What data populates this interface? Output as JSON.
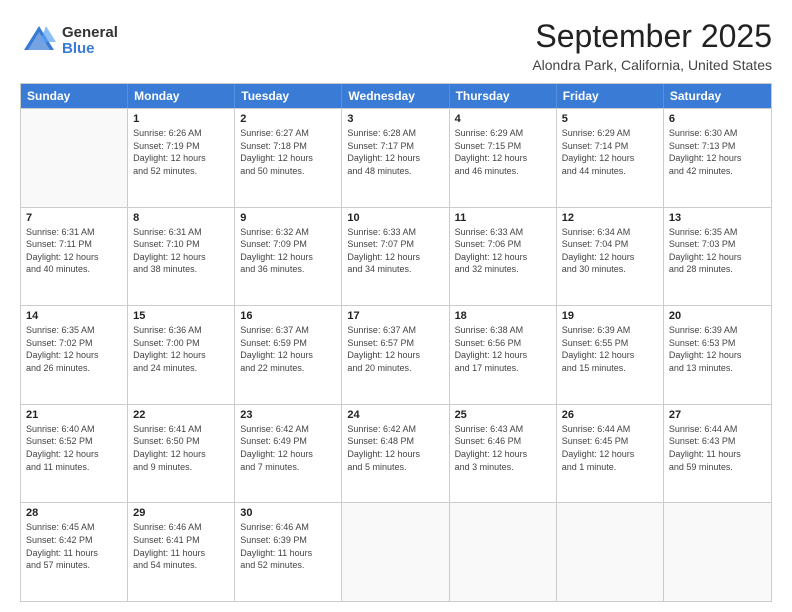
{
  "logo": {
    "general": "General",
    "blue": "Blue"
  },
  "title": "September 2025",
  "subtitle": "Alondra Park, California, United States",
  "header_days": [
    "Sunday",
    "Monday",
    "Tuesday",
    "Wednesday",
    "Thursday",
    "Friday",
    "Saturday"
  ],
  "weeks": [
    [
      {
        "num": "",
        "info": ""
      },
      {
        "num": "1",
        "info": "Sunrise: 6:26 AM\nSunset: 7:19 PM\nDaylight: 12 hours\nand 52 minutes."
      },
      {
        "num": "2",
        "info": "Sunrise: 6:27 AM\nSunset: 7:18 PM\nDaylight: 12 hours\nand 50 minutes."
      },
      {
        "num": "3",
        "info": "Sunrise: 6:28 AM\nSunset: 7:17 PM\nDaylight: 12 hours\nand 48 minutes."
      },
      {
        "num": "4",
        "info": "Sunrise: 6:29 AM\nSunset: 7:15 PM\nDaylight: 12 hours\nand 46 minutes."
      },
      {
        "num": "5",
        "info": "Sunrise: 6:29 AM\nSunset: 7:14 PM\nDaylight: 12 hours\nand 44 minutes."
      },
      {
        "num": "6",
        "info": "Sunrise: 6:30 AM\nSunset: 7:13 PM\nDaylight: 12 hours\nand 42 minutes."
      }
    ],
    [
      {
        "num": "7",
        "info": "Sunrise: 6:31 AM\nSunset: 7:11 PM\nDaylight: 12 hours\nand 40 minutes."
      },
      {
        "num": "8",
        "info": "Sunrise: 6:31 AM\nSunset: 7:10 PM\nDaylight: 12 hours\nand 38 minutes."
      },
      {
        "num": "9",
        "info": "Sunrise: 6:32 AM\nSunset: 7:09 PM\nDaylight: 12 hours\nand 36 minutes."
      },
      {
        "num": "10",
        "info": "Sunrise: 6:33 AM\nSunset: 7:07 PM\nDaylight: 12 hours\nand 34 minutes."
      },
      {
        "num": "11",
        "info": "Sunrise: 6:33 AM\nSunset: 7:06 PM\nDaylight: 12 hours\nand 32 minutes."
      },
      {
        "num": "12",
        "info": "Sunrise: 6:34 AM\nSunset: 7:04 PM\nDaylight: 12 hours\nand 30 minutes."
      },
      {
        "num": "13",
        "info": "Sunrise: 6:35 AM\nSunset: 7:03 PM\nDaylight: 12 hours\nand 28 minutes."
      }
    ],
    [
      {
        "num": "14",
        "info": "Sunrise: 6:35 AM\nSunset: 7:02 PM\nDaylight: 12 hours\nand 26 minutes."
      },
      {
        "num": "15",
        "info": "Sunrise: 6:36 AM\nSunset: 7:00 PM\nDaylight: 12 hours\nand 24 minutes."
      },
      {
        "num": "16",
        "info": "Sunrise: 6:37 AM\nSunset: 6:59 PM\nDaylight: 12 hours\nand 22 minutes."
      },
      {
        "num": "17",
        "info": "Sunrise: 6:37 AM\nSunset: 6:57 PM\nDaylight: 12 hours\nand 20 minutes."
      },
      {
        "num": "18",
        "info": "Sunrise: 6:38 AM\nSunset: 6:56 PM\nDaylight: 12 hours\nand 17 minutes."
      },
      {
        "num": "19",
        "info": "Sunrise: 6:39 AM\nSunset: 6:55 PM\nDaylight: 12 hours\nand 15 minutes."
      },
      {
        "num": "20",
        "info": "Sunrise: 6:39 AM\nSunset: 6:53 PM\nDaylight: 12 hours\nand 13 minutes."
      }
    ],
    [
      {
        "num": "21",
        "info": "Sunrise: 6:40 AM\nSunset: 6:52 PM\nDaylight: 12 hours\nand 11 minutes."
      },
      {
        "num": "22",
        "info": "Sunrise: 6:41 AM\nSunset: 6:50 PM\nDaylight: 12 hours\nand 9 minutes."
      },
      {
        "num": "23",
        "info": "Sunrise: 6:42 AM\nSunset: 6:49 PM\nDaylight: 12 hours\nand 7 minutes."
      },
      {
        "num": "24",
        "info": "Sunrise: 6:42 AM\nSunset: 6:48 PM\nDaylight: 12 hours\nand 5 minutes."
      },
      {
        "num": "25",
        "info": "Sunrise: 6:43 AM\nSunset: 6:46 PM\nDaylight: 12 hours\nand 3 minutes."
      },
      {
        "num": "26",
        "info": "Sunrise: 6:44 AM\nSunset: 6:45 PM\nDaylight: 12 hours\nand 1 minute."
      },
      {
        "num": "27",
        "info": "Sunrise: 6:44 AM\nSunset: 6:43 PM\nDaylight: 11 hours\nand 59 minutes."
      }
    ],
    [
      {
        "num": "28",
        "info": "Sunrise: 6:45 AM\nSunset: 6:42 PM\nDaylight: 11 hours\nand 57 minutes."
      },
      {
        "num": "29",
        "info": "Sunrise: 6:46 AM\nSunset: 6:41 PM\nDaylight: 11 hours\nand 54 minutes."
      },
      {
        "num": "30",
        "info": "Sunrise: 6:46 AM\nSunset: 6:39 PM\nDaylight: 11 hours\nand 52 minutes."
      },
      {
        "num": "",
        "info": ""
      },
      {
        "num": "",
        "info": ""
      },
      {
        "num": "",
        "info": ""
      },
      {
        "num": "",
        "info": ""
      }
    ]
  ]
}
